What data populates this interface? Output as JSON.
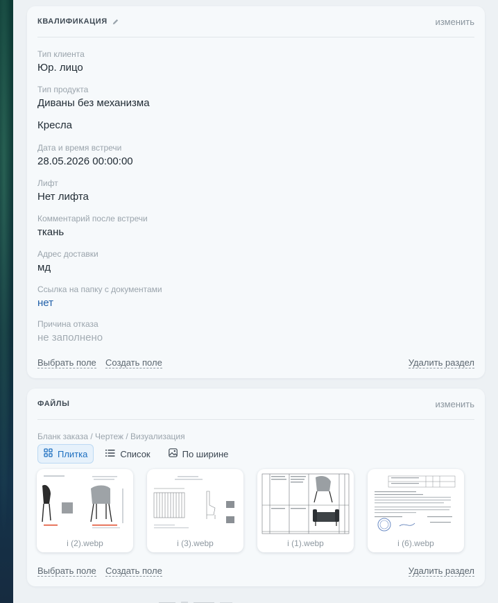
{
  "qualification": {
    "title": "КВАЛИФИКАЦИЯ",
    "edit_label": "изменить",
    "fields": [
      {
        "label": "Тип клиента",
        "values": [
          "Юр. лицо"
        ]
      },
      {
        "label": "Тип продукта",
        "values": [
          "Диваны без механизма",
          "Кресла"
        ]
      },
      {
        "label": "Дата и время встречи",
        "values": [
          "28.05.2026 00:00:00"
        ]
      },
      {
        "label": "Лифт",
        "values": [
          "Нет лифта"
        ]
      },
      {
        "label": "Комментарий после встречи",
        "values": [
          "ткань"
        ]
      },
      {
        "label": "Адрес доставки",
        "values": [
          "мд"
        ]
      },
      {
        "label": "Ссылка на папку с документами",
        "values": [
          "нет"
        ]
      },
      {
        "label": "Причина отказа",
        "values": [
          "не заполнено"
        ]
      }
    ],
    "footer": {
      "choose_field": "Выбрать поле",
      "create_field": "Создать поле",
      "delete_section": "Удалить раздел"
    }
  },
  "files": {
    "title": "ФАЙЛЫ",
    "edit_label": "изменить",
    "field_label": "Бланк заказа / Чертеж / Визуализация",
    "views": [
      {
        "label": "Плитка",
        "icon": "grid-icon",
        "active": true
      },
      {
        "label": "Список",
        "icon": "list-icon",
        "active": false
      },
      {
        "label": "По ширине",
        "icon": "image-icon",
        "active": false
      }
    ],
    "items": [
      {
        "name": "i (2).webp"
      },
      {
        "name": "i (3).webp"
      },
      {
        "name": "i (1).webp"
      },
      {
        "name": "i (6).webp"
      }
    ],
    "footer": {
      "choose_field": "Выбрать поле",
      "create_field": "Создать поле",
      "delete_section": "Удалить раздел"
    }
  },
  "colors": {
    "accent": "#1d6fc0",
    "link": "#1f5fa8",
    "card_bg": "#f6f9fb",
    "page_bg": "#edf1f4"
  }
}
